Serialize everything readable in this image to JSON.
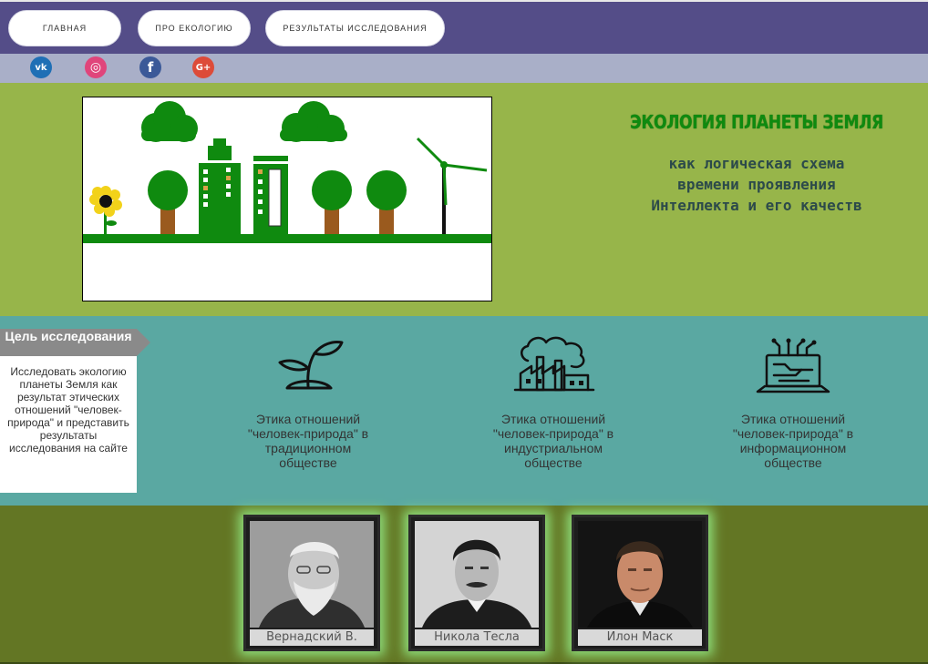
{
  "nav": {
    "items": [
      {
        "label": "ГЛАВНАЯ"
      },
      {
        "label": "ПРО ЕКОЛОГИЮ"
      },
      {
        "label": "РЕЗУЛЬТАТЫ ИССЛЕДОВАНИЯ"
      }
    ]
  },
  "social": [
    {
      "icon": "vk-icon",
      "glyph": "vk",
      "color": "#1f6fb5"
    },
    {
      "icon": "instagram-icon",
      "glyph": "◎",
      "color": "#e0457b"
    },
    {
      "icon": "facebook-icon",
      "glyph": "f",
      "color": "#3b5998"
    },
    {
      "icon": "google-plus-icon",
      "glyph": "G+",
      "color": "#dd4b39"
    }
  ],
  "hero": {
    "title": "ЭКОЛОГИЯ ПЛАНЕТЫ ЗЕМЛЯ",
    "subtitle": "как логическая схема\nвремени проявления\nИнтеллекта и его качеств"
  },
  "goal": {
    "heading": "Цель исследования",
    "text": "Исследовать экологию планеты Земля как результат этических отношений \"человек-природа\" и представить результаты исследования на сайте"
  },
  "ethics": [
    {
      "icon": "sprout-icon",
      "label": "Этика отношений \"человек-природа\" в традиционном обществе"
    },
    {
      "icon": "factory-icon",
      "label": "Этика отношений \"человек-природа\" в индустриальном обществе"
    },
    {
      "icon": "laptop-circuit-icon",
      "label": "Этика отношений \"человек-природа\" в информационном обществе"
    }
  ],
  "people": [
    {
      "name": "Вернадский В."
    },
    {
      "name": "Никола Тесла"
    },
    {
      "name": "Илон Маск"
    }
  ],
  "colors": {
    "nav_bg": "#544d88",
    "social_bg": "#a9afc8",
    "hero_bg": "#97b54a",
    "goal_bg": "#5aa8a2",
    "people_bg": "#637624",
    "title_green": "#0f8a0f"
  }
}
